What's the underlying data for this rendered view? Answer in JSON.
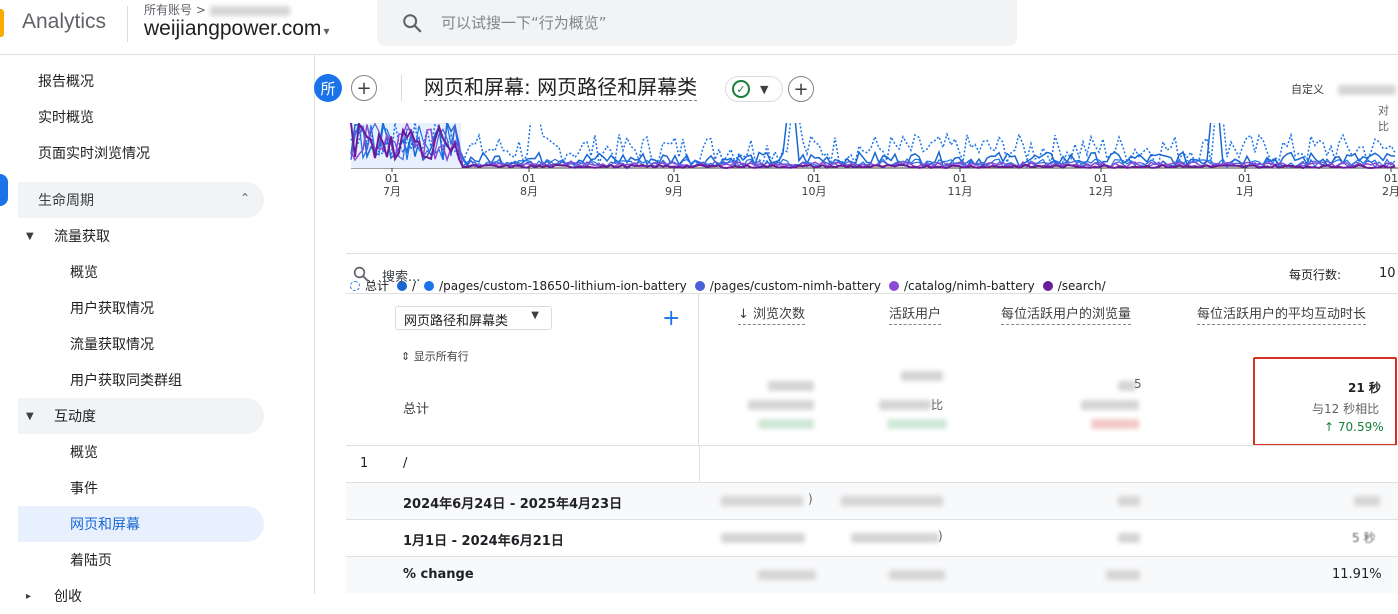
{
  "app": {
    "name": "Analytics"
  },
  "account": {
    "label_prefix": "所有账号 >",
    "property": "weijiangpower.com",
    "caret": "▾"
  },
  "search": {
    "placeholder": "可以试搜一下“行为概览”"
  },
  "sidebar": {
    "items": [
      {
        "label": "报告概况"
      },
      {
        "label": "实时概览"
      },
      {
        "label": "页面实时浏览情况"
      }
    ],
    "section": {
      "label": "生命周期",
      "chevron": "⌃"
    },
    "groups": [
      {
        "label": "流量获取",
        "children": [
          "概览",
          "用户获取情况",
          "流量获取情况",
          "用户获取同类群组"
        ]
      },
      {
        "label": "互动度",
        "children": [
          "概览",
          "事件",
          "网页和屏幕",
          "着陆页"
        ]
      }
    ],
    "cut_label": "创收"
  },
  "header": {
    "avatar": "所",
    "title": "网页和屏幕: 网页路径和屏幕类",
    "custom_label": "自定义",
    "compare_label": "对比"
  },
  "chart_data": {
    "type": "line",
    "x_ticks": [
      {
        "day": "01",
        "month": "7月"
      },
      {
        "day": "01",
        "month": "8月"
      },
      {
        "day": "01",
        "month": "9月"
      },
      {
        "day": "01",
        "month": "10月"
      },
      {
        "day": "01",
        "month": "11月"
      },
      {
        "day": "01",
        "month": "12月"
      },
      {
        "day": "01",
        "month": "1月"
      },
      {
        "day": "01",
        "month": "2月"
      }
    ],
    "legend": [
      {
        "name": "总计",
        "color": "#1a73e8",
        "style": "dashed"
      },
      {
        "name": "/",
        "color": "#1967d2"
      },
      {
        "name": "/pages/custom-18650-lithium-ion-battery",
        "color": "#1a73e8"
      },
      {
        "name": "/pages/custom-nimh-battery",
        "color": "#4c5fd7"
      },
      {
        "name": "/catalog/nimh-battery",
        "color": "#8c4ad6"
      },
      {
        "name": "/search/",
        "color": "#6a1b9a"
      }
    ]
  },
  "table": {
    "search_placeholder": "搜索...",
    "rows_per_page_label": "每页行数:",
    "rows_per_page": "10",
    "dimension": "网页路径和屏幕类",
    "add": "+",
    "show_all": "显示所有行",
    "total_label": "总计",
    "metrics": [
      "浏览次数",
      "活跃用户",
      "每位活跃用户的浏览量",
      "每位活跃用户的平均互动时长"
    ],
    "sort_arrow": "↓",
    "highlight": {
      "value": "21 秒",
      "compare": "与12 秒相比",
      "change": "↑ 70.59%"
    },
    "partials": {
      "total_users_suffix": "比",
      "total_pv_suffix": "5"
    },
    "rows": [
      {
        "index": "1",
        "label": "/"
      },
      {
        "index": "",
        "label": "2024年6月24日 - 2025年4月23日",
        "bracket": ")"
      },
      {
        "index": "",
        "label": "1月1日 - 2024年6月21日",
        "bracket": ")",
        "last": "5 秒"
      },
      {
        "index": "",
        "label": "% change",
        "last": "11.91%"
      }
    ]
  }
}
